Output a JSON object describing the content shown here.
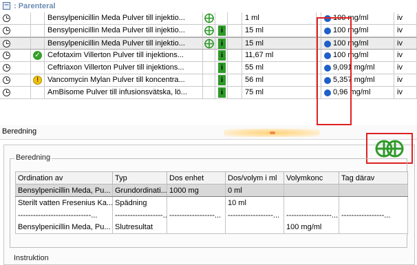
{
  "group": {
    "collapse_glyph": "−",
    "title": ": Parenteral"
  },
  "medications": [
    {
      "name": "Bensylpenicillin Meda Pulver till injektio...",
      "status_icon": "none",
      "has_cross_icon": true,
      "has_info_icon": false,
      "volume": "1 ml",
      "concentration": "100 mg/ml",
      "route": "iv"
    },
    {
      "name": "Bensylpenicillin Meda Pulver till injektio...",
      "status_icon": "none",
      "has_cross_icon": true,
      "has_info_icon": true,
      "volume": "15 ml",
      "concentration": "100 mg/ml",
      "route": "iv"
    },
    {
      "name": "Bensylpenicillin Meda Pulver till injektio...",
      "status_icon": "none",
      "has_cross_icon": true,
      "has_info_icon": true,
      "volume": "15 ml",
      "concentration": "100 mg/ml",
      "route": "iv",
      "selected": true
    },
    {
      "name": "Cefotaxim Villerton Pulver till injektions...",
      "status_icon": "check-icon",
      "has_cross_icon": false,
      "has_info_icon": true,
      "volume": "11,67 ml",
      "concentration": "100 mg/ml",
      "route": "iv"
    },
    {
      "name": "Ceftriaxon Villerton Pulver till injektions...",
      "status_icon": "none",
      "has_cross_icon": false,
      "has_info_icon": true,
      "volume": "55 ml",
      "concentration": "9,091 mg/ml",
      "route": "iv"
    },
    {
      "name": "Vancomycin Mylan Pulver till koncentra...",
      "status_icon": "warning-icon",
      "has_cross_icon": false,
      "has_info_icon": true,
      "volume": "56 ml",
      "concentration": "5,357 mg/ml",
      "route": "iv"
    },
    {
      "name": "AmBisome Pulver till infusionsvätska, lö...",
      "status_icon": "none",
      "has_cross_icon": false,
      "has_info_icon": true,
      "volume": "75 ml",
      "concentration": "0,96 mg/ml",
      "route": "iv"
    }
  ],
  "info_glyph": "i",
  "warn_glyph": "!",
  "check_glyph": "✓",
  "beredning_bar": {
    "title": "Beredning"
  },
  "beredning_panel": {
    "legend": "Beredning",
    "columns": [
      "Ordination av",
      "Typ",
      "Dos enhet",
      "Dos/volym i ml",
      "Volymkonc",
      "Tag därav"
    ],
    "rows": [
      [
        "Bensylpenicillin Meda, Pu...",
        "Grundordinati...",
        "1000 mg",
        "0 ml",
        "",
        ""
      ],
      [
        "Sterilt vatten Fresenius Ka...",
        "Spädning",
        "",
        "10 ml",
        "",
        ""
      ],
      [
        "-----------------------------...",
        "-------------------...",
        "------------------...",
        "------------------...",
        "------------------...",
        "-----------------..."
      ],
      [
        "Bensylpenicillin Meda, Pu...",
        "Slutresultat",
        "",
        "",
        "100 mg/ml",
        ""
      ]
    ]
  },
  "instruktion_label": "Instruktion",
  "colors": {
    "highlight": "#e02020",
    "dot": "#1f5fc8",
    "green": "#2f9a2a",
    "group_title": "#6b8bb5"
  }
}
